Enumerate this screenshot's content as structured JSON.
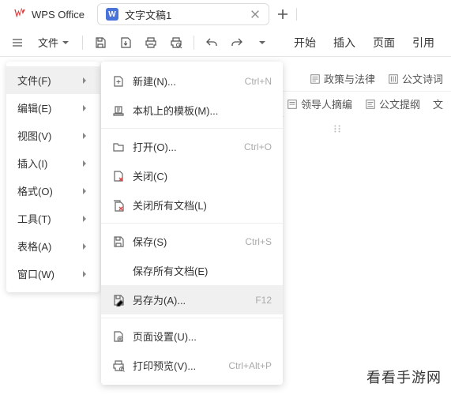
{
  "titlebar": {
    "app_name": "WPS Office",
    "tab_title": "文字文稿1"
  },
  "toolbar": {
    "file_label": "文件",
    "menu_tabs": [
      "开始",
      "插入",
      "页面",
      "引用"
    ]
  },
  "chips_row1": [
    {
      "icon": "doc",
      "label": "政策与法律"
    },
    {
      "icon": "doc",
      "label": "公文诗词"
    }
  ],
  "chips_row2": [
    {
      "icon": "doc",
      "label": "领导人摘编"
    },
    {
      "icon": "doc",
      "label": "公文提纲"
    },
    {
      "icon": "doc",
      "label": "文"
    }
  ],
  "side_menu": [
    {
      "label": "文件(F)",
      "hovered": true
    },
    {
      "label": "编辑(E)"
    },
    {
      "label": "视图(V)"
    },
    {
      "label": "插入(I)"
    },
    {
      "label": "格式(O)"
    },
    {
      "label": "工具(T)"
    },
    {
      "label": "表格(A)"
    },
    {
      "label": "窗口(W)"
    }
  ],
  "flyout": [
    {
      "icon": "new",
      "label": "新建(N)...",
      "shortcut": "Ctrl+N"
    },
    {
      "icon": "template",
      "label": "本机上的模板(M)..."
    },
    {
      "sep": true
    },
    {
      "icon": "open",
      "label": "打开(O)...",
      "shortcut": "Ctrl+O"
    },
    {
      "icon": "close",
      "label": "关闭(C)"
    },
    {
      "icon": "closeall",
      "label": "关闭所有文档(L)"
    },
    {
      "sep": true
    },
    {
      "icon": "save",
      "label": "保存(S)",
      "shortcut": "Ctrl+S"
    },
    {
      "icon": "blank",
      "label": "保存所有文档(E)"
    },
    {
      "icon": "saveas",
      "label": "另存为(A)...",
      "shortcut": "F12",
      "hovered": true
    },
    {
      "sep": true
    },
    {
      "icon": "pagesetup",
      "label": "页面设置(U)..."
    },
    {
      "icon": "printpreview",
      "label": "打印预览(V)...",
      "shortcut": "Ctrl+Alt+P"
    }
  ],
  "watermark": "看看手游网"
}
